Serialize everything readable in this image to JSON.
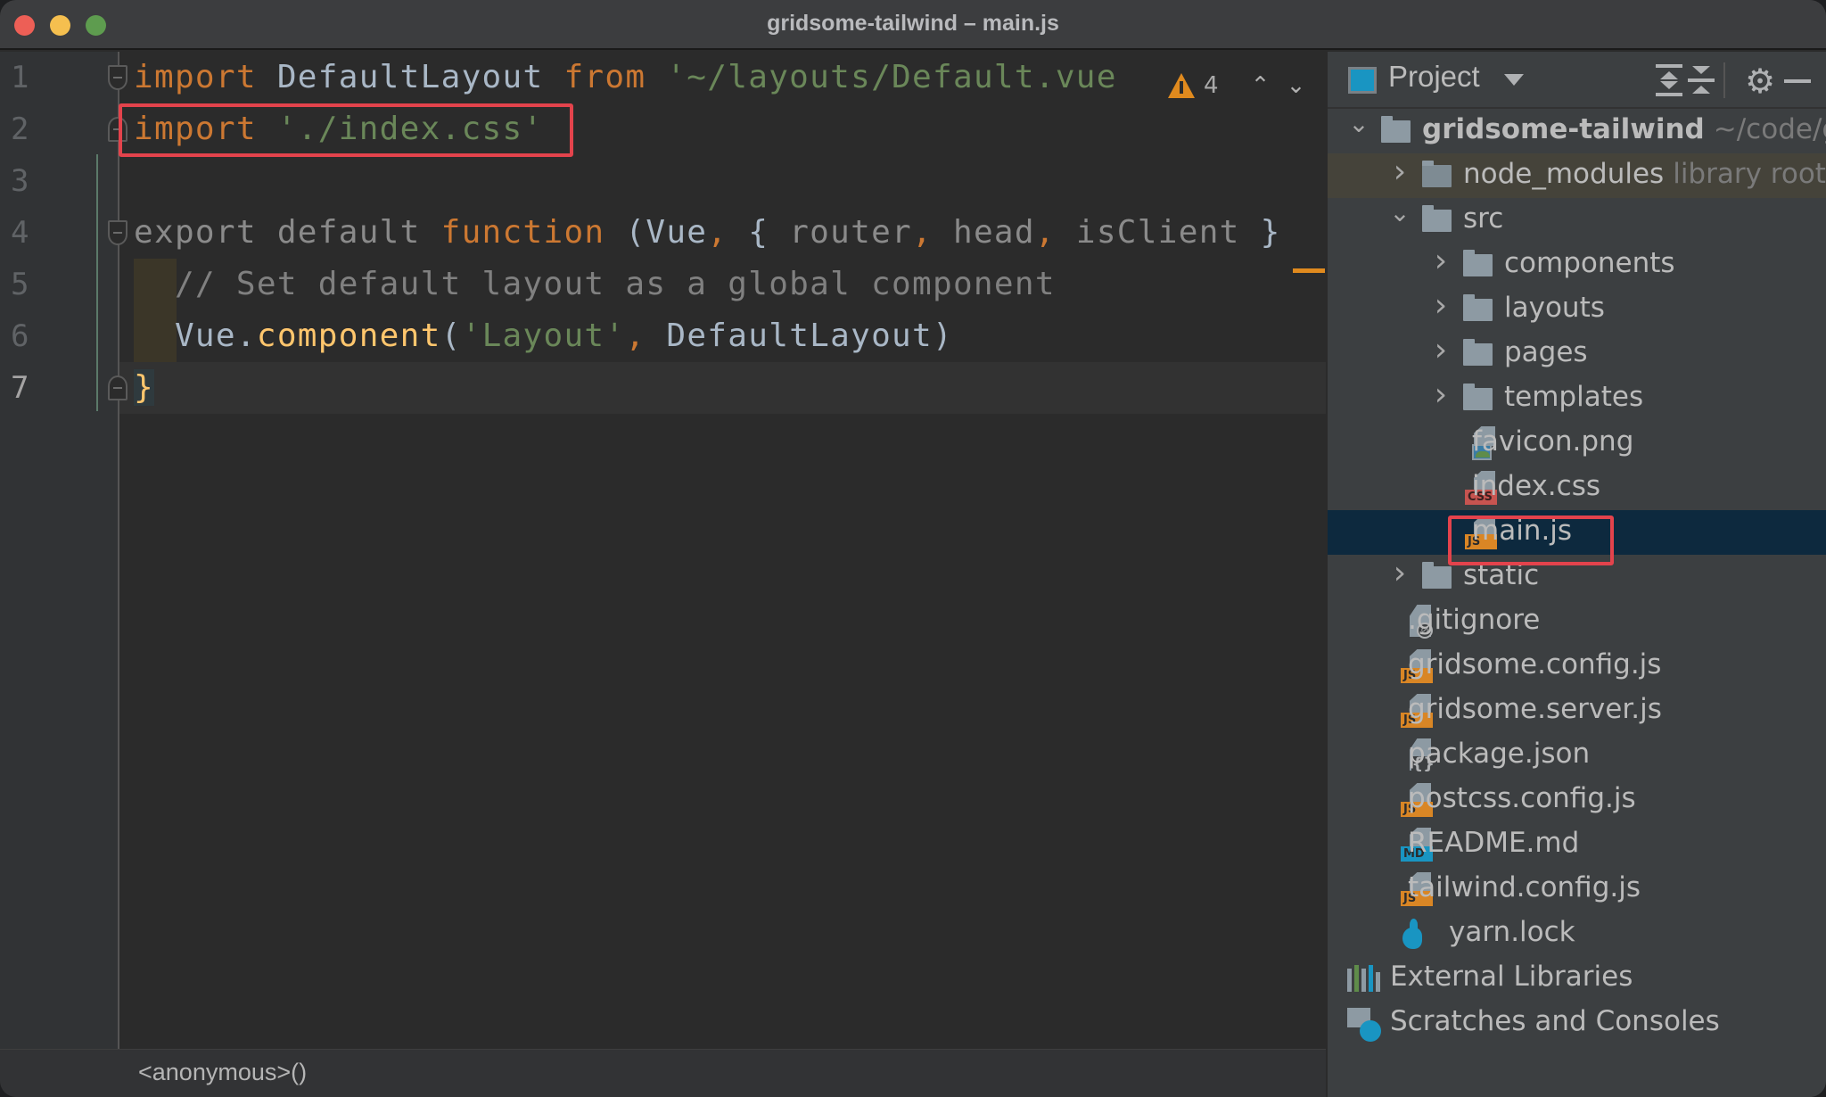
{
  "window": {
    "title": "gridsome-tailwind – main.js"
  },
  "editor": {
    "line_numbers": [
      "1",
      "2",
      "3",
      "4",
      "5",
      "6",
      "7"
    ],
    "current_line": "7",
    "lines": [
      [
        {
          "t": "import",
          "c": "kw"
        },
        {
          "t": " DefaultLayout ",
          "c": "plain"
        },
        {
          "t": "from",
          "c": "kw"
        },
        {
          "t": " '~/layouts/Default.vue",
          "c": "str"
        }
      ],
      [
        {
          "t": "import",
          "c": "kw"
        },
        {
          "t": " './index.css'",
          "c": "str"
        }
      ],
      [],
      [
        {
          "t": "export default ",
          "c": "dim"
        },
        {
          "t": "function",
          "c": "kw"
        },
        {
          "t": " (Vue",
          "c": "plain"
        },
        {
          "t": ",",
          "c": "kw"
        },
        {
          "t": " { ",
          "c": "plain"
        },
        {
          "t": "router",
          "c": "dim"
        },
        {
          "t": ",",
          "c": "kw"
        },
        {
          "t": " head",
          "c": "dim"
        },
        {
          "t": ",",
          "c": "kw"
        },
        {
          "t": " isClient",
          "c": "dim"
        },
        {
          "t": " }",
          "c": "plain"
        }
      ],
      [
        {
          "t": "  // Set default layout as a global component",
          "c": "cm"
        }
      ],
      [
        {
          "t": "  Vue.",
          "c": "plain"
        },
        {
          "t": "component",
          "c": "fn"
        },
        {
          "t": "(",
          "c": "plain"
        },
        {
          "t": "'Layout'",
          "c": "str"
        },
        {
          "t": ",",
          "c": "kw"
        },
        {
          "t": " DefaultLayout)",
          "c": "plain"
        }
      ],
      [
        {
          "t": "}",
          "c": "brace"
        }
      ]
    ],
    "inspections": {
      "warning_count": "4",
      "prev_icon": "chevron-up-icon",
      "next_icon": "chevron-down-icon"
    },
    "breadcrumb": "<anonymous>()"
  },
  "project_panel": {
    "title": "Project",
    "toolbar": {
      "expand_all": "expand-all-icon",
      "collapse_all": "collapse-all-icon",
      "settings": "gear-icon",
      "hide": "minimize-icon"
    },
    "tree": [
      {
        "label": "gridsome-tailwind",
        "hint": "~/code/g",
        "type": "folder",
        "depth": 0,
        "expanded": true,
        "bold": true
      },
      {
        "label": "node_modules",
        "hint": "library root",
        "type": "lib-folder",
        "depth": 1,
        "expanded": false
      },
      {
        "label": "src",
        "type": "folder",
        "depth": 1,
        "expanded": true
      },
      {
        "label": "components",
        "type": "folder",
        "depth": 2,
        "expanded": false
      },
      {
        "label": "layouts",
        "type": "folder",
        "depth": 2,
        "expanded": false
      },
      {
        "label": "pages",
        "type": "folder",
        "depth": 2,
        "expanded": false
      },
      {
        "label": "templates",
        "type": "folder",
        "depth": 2,
        "expanded": false
      },
      {
        "label": "favicon.png",
        "type": "image",
        "depth": 2
      },
      {
        "label": "index.css",
        "type": "css",
        "depth": 2
      },
      {
        "label": "main.js",
        "type": "js",
        "depth": 2,
        "selected": true
      },
      {
        "label": "static",
        "type": "folder",
        "depth": 1,
        "expanded": false
      },
      {
        "label": ".gitignore",
        "type": "ignore",
        "depth": 1
      },
      {
        "label": "gridsome.config.js",
        "type": "js",
        "depth": 1
      },
      {
        "label": "gridsome.server.js",
        "type": "js",
        "depth": 1
      },
      {
        "label": "package.json",
        "type": "json",
        "depth": 1
      },
      {
        "label": "postcss.config.js",
        "type": "js",
        "depth": 1
      },
      {
        "label": "README.md",
        "type": "md",
        "depth": 1
      },
      {
        "label": "tailwind.config.js",
        "type": "js",
        "depth": 1
      },
      {
        "label": "yarn.lock",
        "type": "yarn",
        "depth": 1
      },
      {
        "label": "External Libraries",
        "type": "external",
        "depth": 0
      },
      {
        "label": "Scratches and Consoles",
        "type": "scratch",
        "depth": 0
      }
    ]
  },
  "colors": {
    "keyword": "#cc7832",
    "string": "#6a8759",
    "function": "#ffc66d",
    "highlight_box": "#e3434c",
    "selection": "#0d293e"
  }
}
